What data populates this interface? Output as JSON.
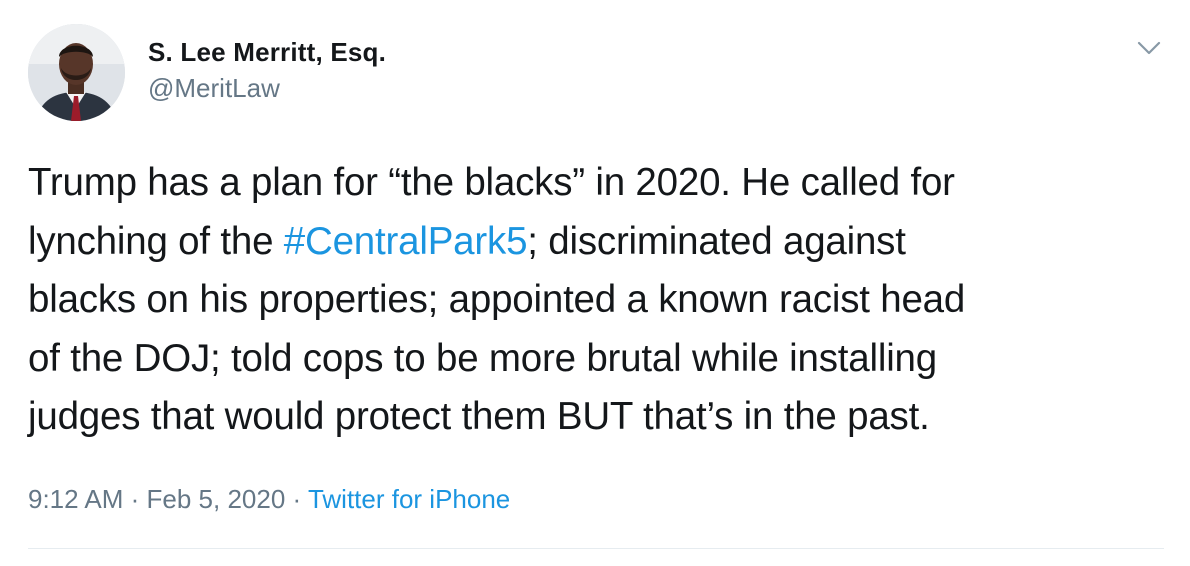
{
  "author": {
    "display_name": "S. Lee Merritt, Esq.",
    "handle": "@MeritLaw"
  },
  "tweet": {
    "line1": "Trump has a plan for “the blacks” in 2020. He called for",
    "line2_before": "lynching of the ",
    "hashtag": "#CentralPark5",
    "line2_after": "; discriminated against",
    "line3": "blacks on his properties; appointed a known racist head",
    "line4": "of the DOJ; told cops to be more brutal while installing",
    "line5": "judges that would protect them BUT that’s in the past."
  },
  "meta": {
    "time": "9:12 AM",
    "separator": " · ",
    "date": "Feb 5, 2020",
    "source": "Twitter for iPhone"
  },
  "icons": {
    "more": "chevron-down-icon",
    "avatar": "avatar"
  },
  "colors": {
    "text": "#14171a",
    "secondary": "#657786",
    "link": "#1b95e0",
    "divider": "#e6ecf0"
  }
}
